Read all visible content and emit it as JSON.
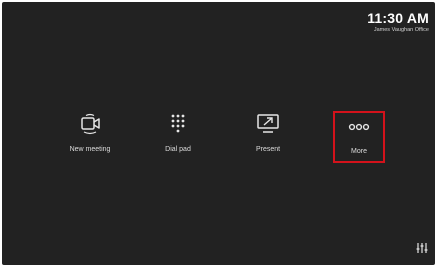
{
  "status": {
    "time": "11:30 AM",
    "room_name": "James Vaughan Office"
  },
  "actions": [
    {
      "label": "New meeting",
      "icon": "video-camera-icon"
    },
    {
      "label": "Dial pad",
      "icon": "dial-pad-icon"
    },
    {
      "label": "Present",
      "icon": "present-screen-icon"
    },
    {
      "label": "More",
      "icon": "more-ellipsis-icon",
      "highlighted": true
    }
  ],
  "footer": {
    "settings_icon": "settings-sliders-icon"
  },
  "colors": {
    "background": "#222222",
    "highlight": "#d3121b",
    "text": "#ffffff"
  }
}
